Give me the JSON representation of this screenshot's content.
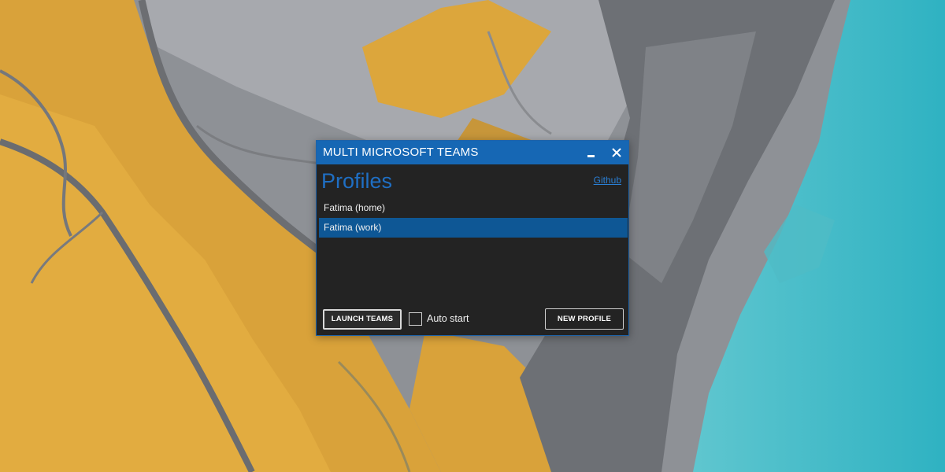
{
  "window": {
    "title": "MULTI MICROSOFT TEAMS",
    "heading": "Profiles",
    "github_link": "Github"
  },
  "profiles": [
    {
      "name": "Fatima (home)",
      "selected": false
    },
    {
      "name": "Fatima (work)",
      "selected": true
    }
  ],
  "controls": {
    "launch_label": "LAUNCH TEAMS",
    "autostart_label": "Auto start",
    "autostart_checked": false,
    "new_profile_label": "NEW PROFILE"
  },
  "icons": {
    "minimize": "minimize-icon",
    "close": "close-icon"
  },
  "colors": {
    "title_bar": "#1667b4",
    "window_bg": "#232323",
    "heading": "#1f6fc4",
    "selected_row": "#0e5795",
    "link": "#2a7fd4"
  }
}
